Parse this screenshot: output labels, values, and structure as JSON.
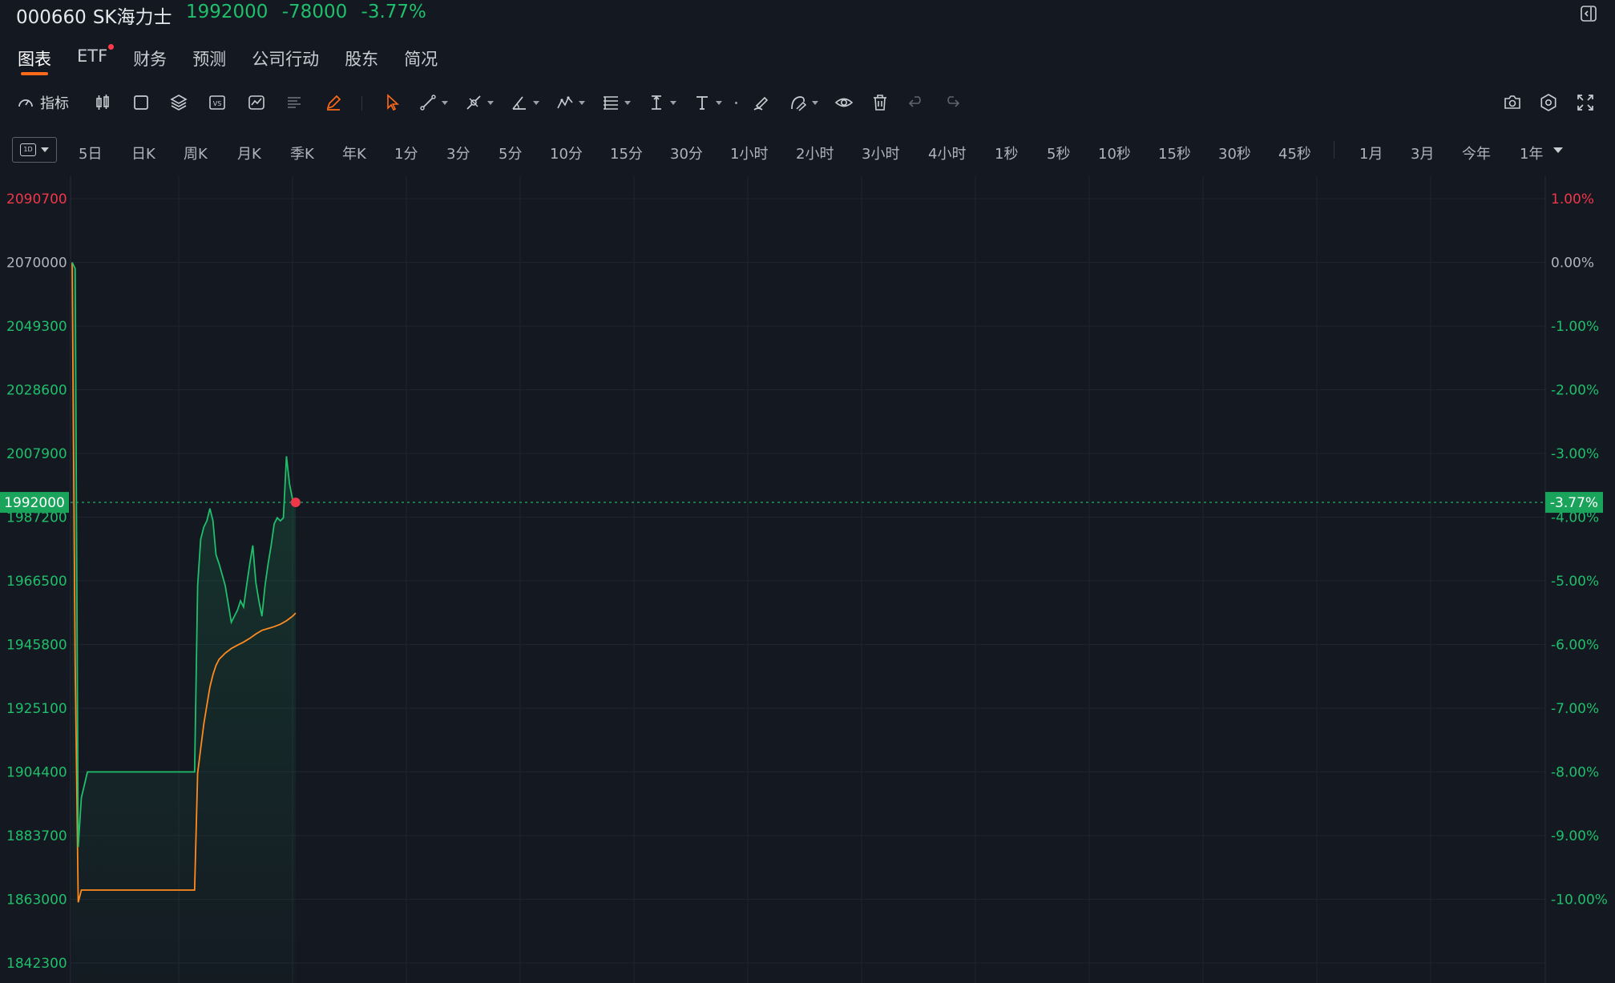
{
  "header": {
    "code": "000660",
    "name": "SK海力士",
    "price": "1992000",
    "change": "-78000",
    "change_pct": "-3.77%",
    "quote_color": "#1fbf6b"
  },
  "tabs": [
    {
      "label": "图表",
      "active": true
    },
    {
      "label": "ETF",
      "badge": true
    },
    {
      "label": "财务"
    },
    {
      "label": "预测"
    },
    {
      "label": "公司行动"
    },
    {
      "label": "股东"
    },
    {
      "label": "简况"
    }
  ],
  "toolbar": {
    "indicators_label": "指标",
    "icons": [
      "candlestick-icon",
      "rectangle-icon",
      "layers-icon",
      "compare-vs-icon",
      "chart-type-icon",
      "text-align-icon",
      "pencil-icon",
      "cursor-icon",
      "trend-line-icon",
      "pen-tool-icon",
      "angle-icon",
      "pattern-icon",
      "fib-icon",
      "measure-icon",
      "text-icon",
      "brush-icon",
      "draw-icon",
      "eye-icon",
      "trash-icon",
      "undo-icon",
      "redo-icon",
      "camera-icon",
      "settings-icon",
      "fullscreen-icon"
    ]
  },
  "intervals": {
    "period_icon_text": "1D",
    "items": [
      "5日",
      "日K",
      "周K",
      "月K",
      "季K",
      "年K",
      "1分",
      "3分",
      "5分",
      "10分",
      "15分",
      "30分",
      "1小时",
      "2小时",
      "3小时",
      "4小时",
      "1秒",
      "5秒",
      "10秒",
      "15秒",
      "30秒",
      "45秒"
    ],
    "ranges": [
      "1月",
      "3月",
      "今年",
      "1年"
    ]
  },
  "chart_data": {
    "type": "line",
    "title": "",
    "colors": {
      "price": "#1fbf6b",
      "avg": "#ff8a1f",
      "up": "#f0374a",
      "down": "#1fbf6b",
      "neutral": "#aeb3bc"
    },
    "y_left_ticks": [
      "2090700",
      "2070000",
      "2049300",
      "2028600",
      "2007900",
      "1987200",
      "1966500",
      "1945800",
      "1925100",
      "1904400",
      "1883700",
      "1863000",
      "1842300"
    ],
    "y_right_ticks": [
      "1.00%",
      "0.00%",
      "-1.00%",
      "-2.00%",
      "-3.00%",
      "-4.00%",
      "-5.00%",
      "-6.00%",
      "-7.00%",
      "-8.00%",
      "-9.00%",
      "-10.00%"
    ],
    "ylim": [
      1842300,
      2090700
    ],
    "prev_close": 2070000,
    "current_price": 1992000,
    "current_label": "1992000",
    "current_pct_label": "-3.77%",
    "price_series": {
      "name": "",
      "t": [
        0,
        1,
        2,
        3,
        5,
        10,
        40,
        41,
        42,
        43,
        44,
        45,
        46,
        47,
        48,
        50,
        52,
        54,
        55,
        56,
        57,
        58,
        59,
        60,
        61,
        62,
        63,
        64,
        65,
        66,
        67,
        68,
        69,
        70,
        71,
        72,
        73
      ],
      "v": [
        2070000,
        2068000,
        1880000,
        1896000,
        1904400,
        1904400,
        1904400,
        1965000,
        1980000,
        1984000,
        1986000,
        1990000,
        1986000,
        1975000,
        1972000,
        1965000,
        1953000,
        1957000,
        1960000,
        1958000,
        1965000,
        1972000,
        1978000,
        1966000,
        1960000,
        1955000,
        1965000,
        1972000,
        1978000,
        1985000,
        1987000,
        1986000,
        1987000,
        2007000,
        1998000,
        1993000,
        1992000
      ]
    },
    "avg_series": {
      "name": "",
      "t": [
        0,
        1,
        2,
        3,
        5,
        40,
        41,
        42,
        43,
        44,
        45,
        46,
        47,
        48,
        50,
        52,
        54,
        56,
        58,
        60,
        62,
        64,
        66,
        68,
        70,
        72,
        73
      ],
      "v": [
        2070000,
        1940000,
        1862000,
        1866000,
        1866000,
        1866000,
        1904000,
        1912000,
        1920000,
        1926000,
        1932000,
        1936000,
        1939000,
        1941000,
        1943000,
        1944500,
        1945600,
        1946600,
        1947800,
        1949200,
        1950400,
        1951000,
        1951600,
        1952400,
        1953500,
        1955000,
        1956000
      ]
    },
    "x_span": 360
  }
}
